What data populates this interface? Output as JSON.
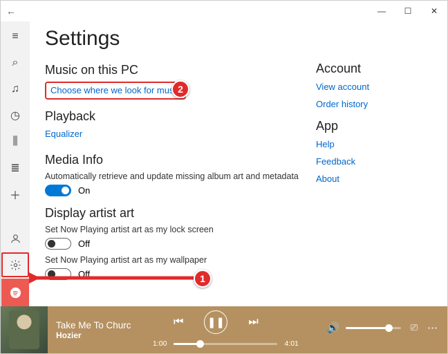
{
  "window": {
    "back_icon": "←",
    "min": "—",
    "max": "☐",
    "close": "✕"
  },
  "sidebar": [
    {
      "name": "hamburger-icon",
      "label": "≡"
    },
    {
      "name": "search-icon",
      "label": "⌕"
    },
    {
      "name": "music-icon",
      "label": "♫"
    },
    {
      "name": "recent-icon",
      "label": "◷"
    },
    {
      "name": "now-playing-icon",
      "label": "⫼"
    },
    {
      "name": "playlists-icon",
      "label": "≣"
    },
    {
      "name": "add-icon",
      "label": "＋"
    }
  ],
  "sidebar_bottom": [
    {
      "name": "account-icon",
      "label": "◯"
    },
    {
      "name": "settings-icon",
      "label": "⚙"
    },
    {
      "name": "spotify-icon",
      "label": "◉"
    }
  ],
  "title": "Settings",
  "sections": {
    "music": {
      "heading": "Music on this PC",
      "link": "Choose where we look for music"
    },
    "playback": {
      "heading": "Playback",
      "link": "Equalizer"
    },
    "media": {
      "heading": "Media Info",
      "desc": "Automatically retrieve and update missing album art and metadata",
      "state": "On"
    },
    "artist": {
      "heading": "Display artist art",
      "opt1": {
        "desc": "Set Now Playing artist art as my lock screen",
        "state": "Off"
      },
      "opt2": {
        "desc": "Set Now Playing artist art as my wallpaper",
        "state": "Off"
      }
    }
  },
  "side": {
    "account": {
      "heading": "Account",
      "view": "View account",
      "order": "Order history"
    },
    "app": {
      "heading": "App",
      "help": "Help",
      "feedback": "Feedback",
      "about": "About"
    }
  },
  "player": {
    "title": "Take Me To Churc",
    "artist": "Hozier",
    "elapsed": "1:00",
    "total": "4:01"
  },
  "annotations": {
    "c1": "1",
    "c2": "2"
  }
}
